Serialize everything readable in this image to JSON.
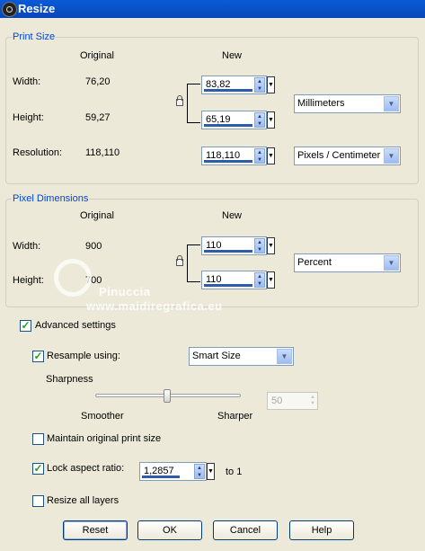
{
  "window": {
    "title": "Resize"
  },
  "print_size": {
    "group_label": "Print Size",
    "col_original": "Original",
    "col_new": "New",
    "width": {
      "label": "Width:",
      "original": "76,20",
      "new": "83,82"
    },
    "height": {
      "label": "Height:",
      "original": "59,27",
      "new": "65,19"
    },
    "resolution": {
      "label": "Resolution:",
      "original": "118,110",
      "new": "118,110"
    },
    "units": "Millimeters",
    "resolution_units": "Pixels / Centimeter"
  },
  "pixel_dimensions": {
    "group_label": "Pixel Dimensions",
    "col_original": "Original",
    "col_new": "New",
    "width": {
      "label": "Width:",
      "original": "900",
      "new": "110"
    },
    "height": {
      "label": "Height:",
      "original": "700",
      "new": "110"
    },
    "units": "Percent"
  },
  "advanced": {
    "label": "Advanced settings",
    "checked": true,
    "resample": {
      "label": "Resample using:",
      "checked": true,
      "method": "Smart Size"
    },
    "sharpness": {
      "label": "Sharpness",
      "left": "Smoother",
      "right": "Sharper",
      "value": "50",
      "level_percent": 50
    },
    "maintain_print_size": {
      "label": "Maintain original print size",
      "checked": false
    },
    "lock_aspect": {
      "label": "Lock aspect ratio:",
      "checked": true,
      "value": "1,2857",
      "suffix": "to 1"
    },
    "resize_all_layers": {
      "label": "Resize all layers",
      "checked": false
    }
  },
  "watermark": {
    "line1": "Pinuccia",
    "line2": "www.maidiregrafica.eu"
  },
  "buttons": {
    "reset": "Reset",
    "ok": "OK",
    "cancel": "Cancel",
    "help": "Help"
  },
  "icons": {
    "app": "app-icon",
    "lock": "lock-icon",
    "spin": "spinner-arrows-icon",
    "dropdown": "chevron-down-icon",
    "check": "checkmark-icon"
  },
  "colors": {
    "title_bar": "#0a5ad8",
    "group_label": "#0046d5",
    "dialog_bg": "#ece9d8"
  }
}
